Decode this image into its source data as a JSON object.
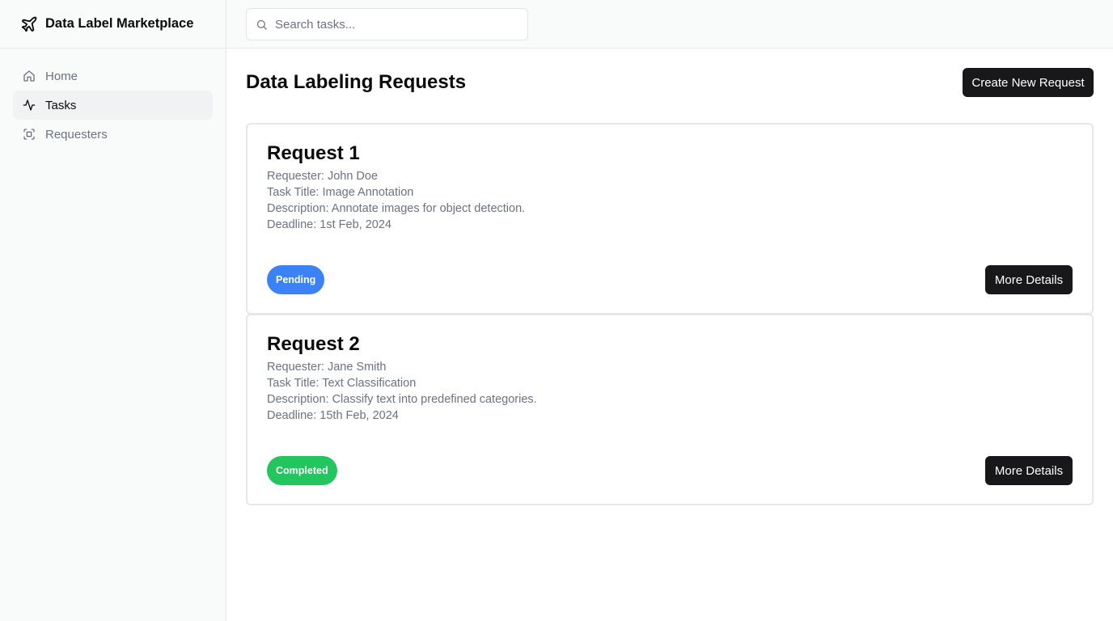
{
  "app": {
    "title": "Data Label Marketplace",
    "logo_icon": "plane-icon"
  },
  "sidebar": {
    "items": [
      {
        "label": "Home",
        "icon": "home-icon",
        "active": false
      },
      {
        "label": "Tasks",
        "icon": "activity-icon",
        "active": true
      },
      {
        "label": "Requesters",
        "icon": "scan-face-icon",
        "active": false
      }
    ]
  },
  "search": {
    "placeholder": "Search tasks...",
    "value": ""
  },
  "main": {
    "title": "Data Labeling Requests",
    "create_button_label": "Create New Request"
  },
  "requests": [
    {
      "title": "Request 1",
      "requester": "Requester: John Doe",
      "task_title": "Task Title: Image Annotation",
      "description": "Description: Annotate images for object detection.",
      "deadline": "Deadline: 1st Feb, 2024",
      "status": "Pending",
      "status_color": "#3b82f6",
      "details_label": "More Details"
    },
    {
      "title": "Request 2",
      "requester": "Requester: Jane Smith",
      "task_title": "Task Title: Text Classification",
      "description": "Description: Classify text into predefined categories.",
      "deadline": "Deadline: 15th Feb, 2024",
      "status": "Completed",
      "status_color": "#22c55e",
      "details_label": "More Details"
    }
  ]
}
